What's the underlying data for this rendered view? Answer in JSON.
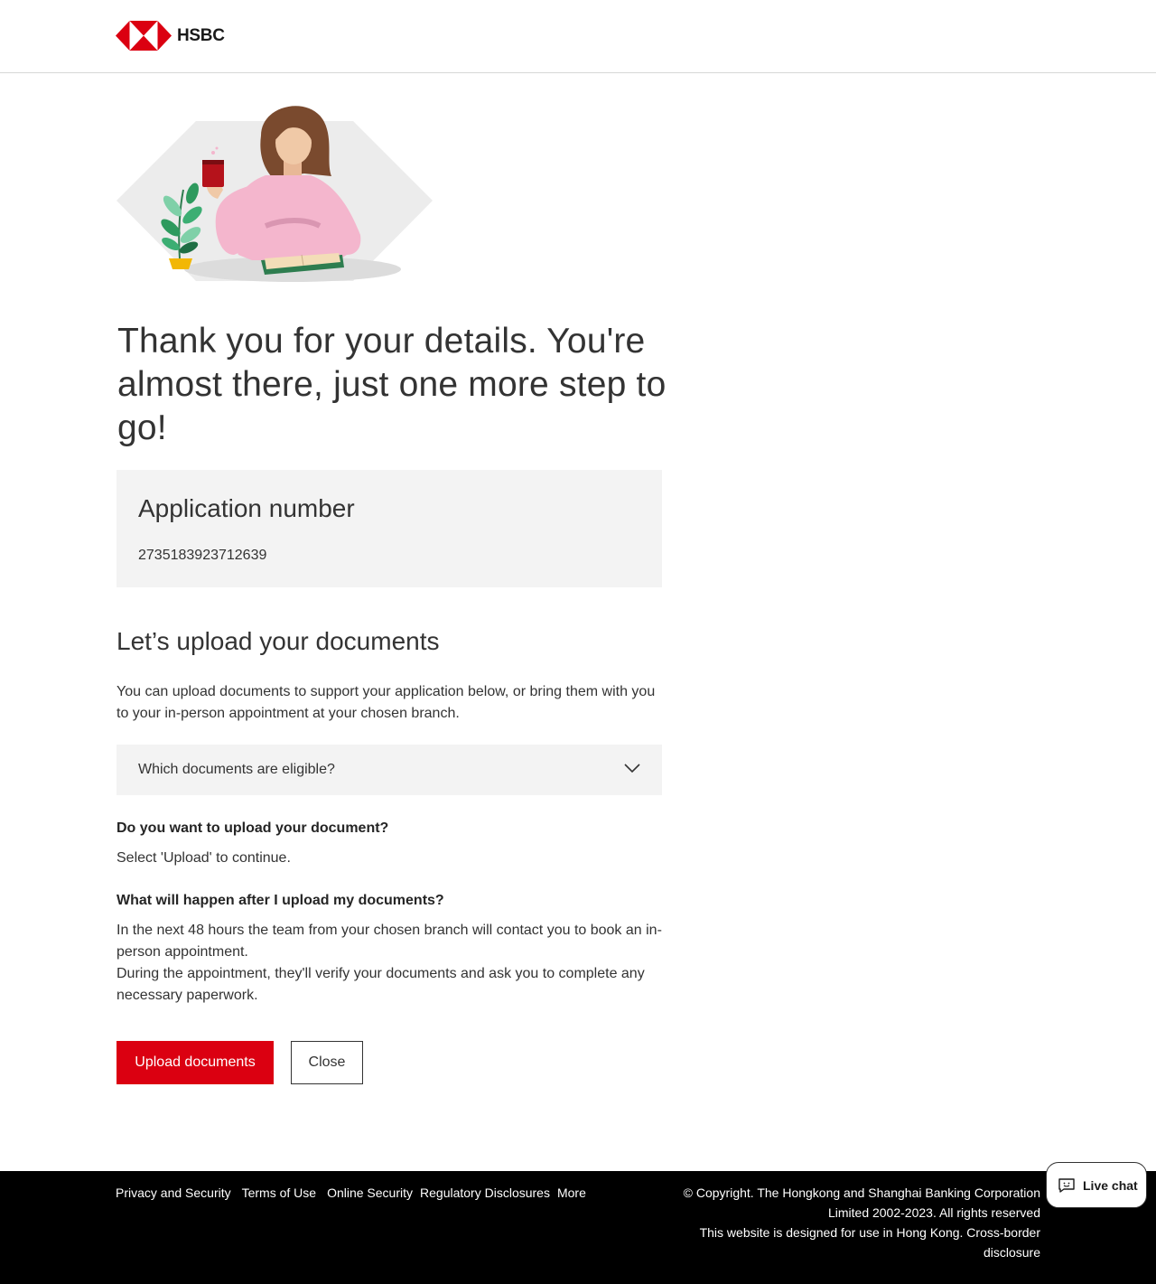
{
  "header": {
    "brand": "HSBC",
    "logo_icon": "hsbc-hexagon-logo"
  },
  "hero": {
    "illustration": "woman-holding-coffee-illustration"
  },
  "main": {
    "title": "Thank you for your details. You're almost there, just one more step to go!",
    "application": {
      "label": "Application number",
      "number": "2735183923712639"
    },
    "upload_heading": "Let’s upload your documents",
    "upload_intro": "You can upload documents to support your application below, or bring them with you to your in-person appointment at your chosen branch.",
    "accordion": {
      "label": "Which documents are eligible?",
      "icon": "chevron-down-icon"
    },
    "faq": [
      {
        "question": "Do you want to upload your document?",
        "answer": "Select 'Upload' to continue."
      },
      {
        "question": "What will happen after I upload my documents?",
        "answer_line1": "In the next 48 hours the team from your chosen branch will contact you to book an in-person appointment.",
        "answer_line2": "During the appointment, they'll verify your documents and ask you to complete any necessary paperwork."
      }
    ],
    "buttons": {
      "upload": "Upload documents",
      "close": "Close"
    }
  },
  "footer": {
    "links": [
      "Privacy and Security",
      "Terms of Use",
      "Online Security",
      "Regulatory Disclosures",
      "More"
    ],
    "copyright_line1": "© Copyright. The Hongkong and Shanghai Banking Corporation Limited 2002-2023. All rights reserved",
    "copyright_line2": "This website is designed for use in Hong Kong. Cross-border disclosure"
  },
  "livechat": {
    "label": "Live chat",
    "icon": "chat-bubble-icon"
  },
  "colors": {
    "brand_red": "#db0011",
    "panel_grey": "#f3f3f3",
    "footer_bg": "#000000"
  }
}
